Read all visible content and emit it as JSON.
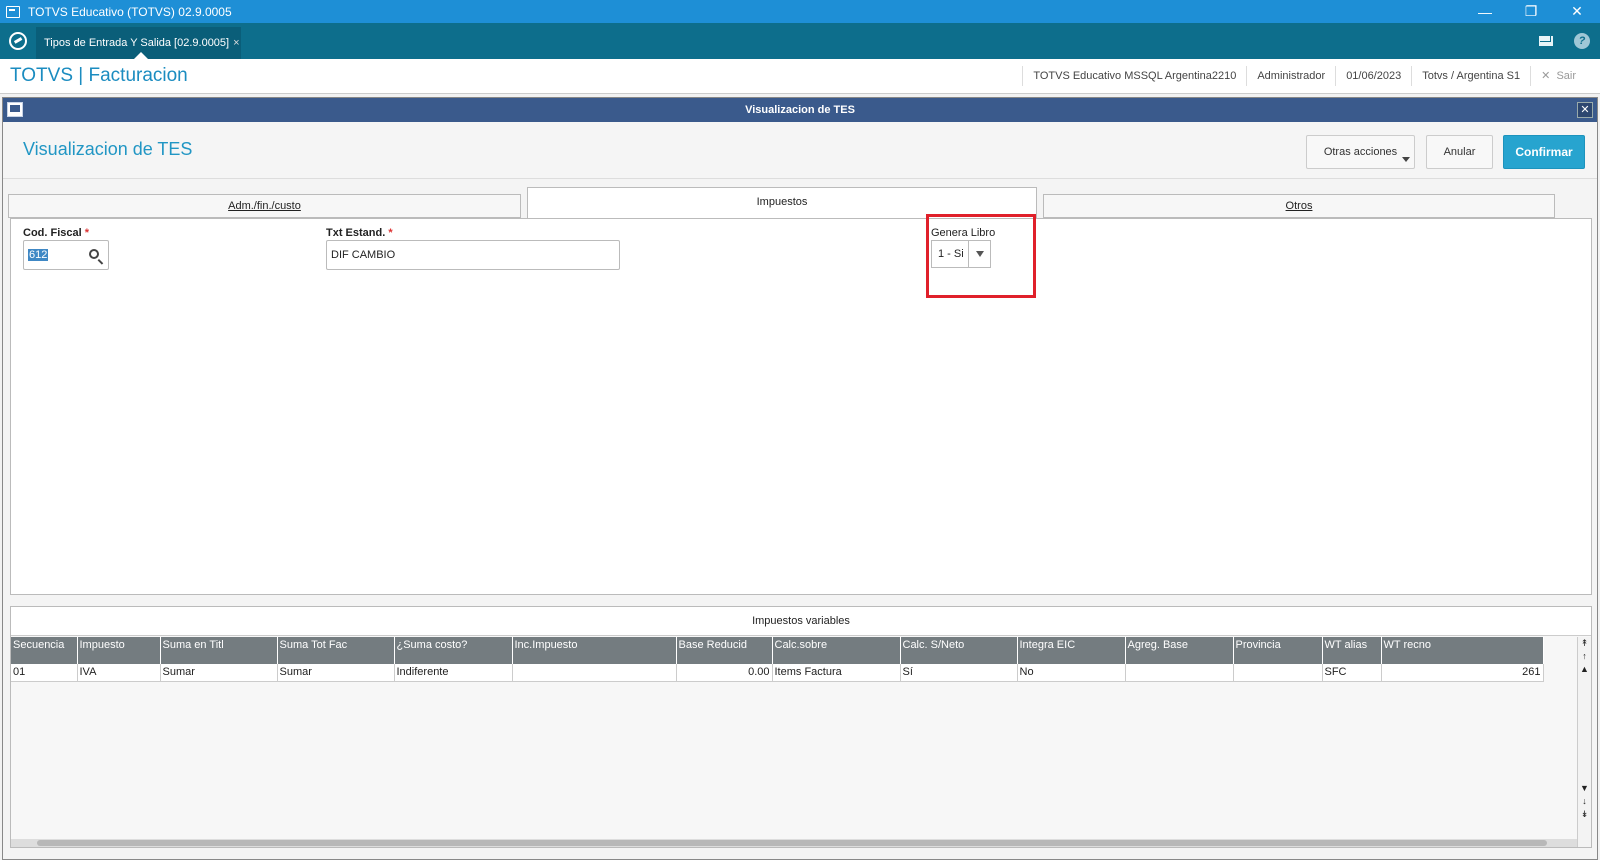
{
  "window": {
    "title": "TOTVS Educativo (TOTVS) 02.9.0005"
  },
  "tabbar": {
    "tab_label": "Tipos de Entrada Y Salida [02.9.0005]",
    "tab_close": "×"
  },
  "header": {
    "app_title": "TOTVS | Facturacion",
    "environment": "TOTVS Educativo MSSQL Argentina2210",
    "user": "Administrador",
    "date": "01/06/2023",
    "company": "Totvs / Argentina S1",
    "exit_label": "Sair"
  },
  "dialog": {
    "title": "Visualizacion de TES",
    "page_title": "Visualizacion de TES",
    "buttons": {
      "otras": "Otras acciones",
      "anular": "Anular",
      "confirmar": "Confirmar"
    },
    "tabs": [
      "Adm./fin./custo",
      "Impuestos",
      "Otros"
    ],
    "fields": {
      "cod_fiscal_label": "Cod. Fiscal",
      "cod_fiscal_value": "612",
      "txt_estand_label": "Txt Estand.",
      "txt_estand_value": "DIF CAMBIO",
      "genera_libro_label": "Genera Libro",
      "genera_libro_value": "1 - Si",
      "required_mark": "*"
    },
    "grid": {
      "title": "Impuestos variables",
      "columns": [
        "Secuencia",
        "Impuesto",
        "Suma en Titl",
        "Suma Tot Fac",
        "¿Suma costo?",
        "Inc.Impuesto",
        "Base Reducid",
        "Calc.sobre",
        "Calc. S/Neto",
        "Integra EIC",
        "Agreg. Base",
        "Provincia",
        "WT alias",
        "WT recno"
      ],
      "rows": [
        [
          "01",
          "IVA",
          "Sumar",
          "Sumar",
          "Indiferente",
          "",
          "0.00",
          "Items Factura",
          "Sí",
          "No",
          "",
          "",
          "SFC",
          "261"
        ]
      ]
    }
  },
  "colors": {
    "accent": "#1b8cc0",
    "titlebar": "#1e8fd6",
    "tabbar": "#0d6e8c",
    "dialog_title": "#3a5a8c",
    "confirm": "#27a4cf",
    "highlight": "#e0202a"
  }
}
